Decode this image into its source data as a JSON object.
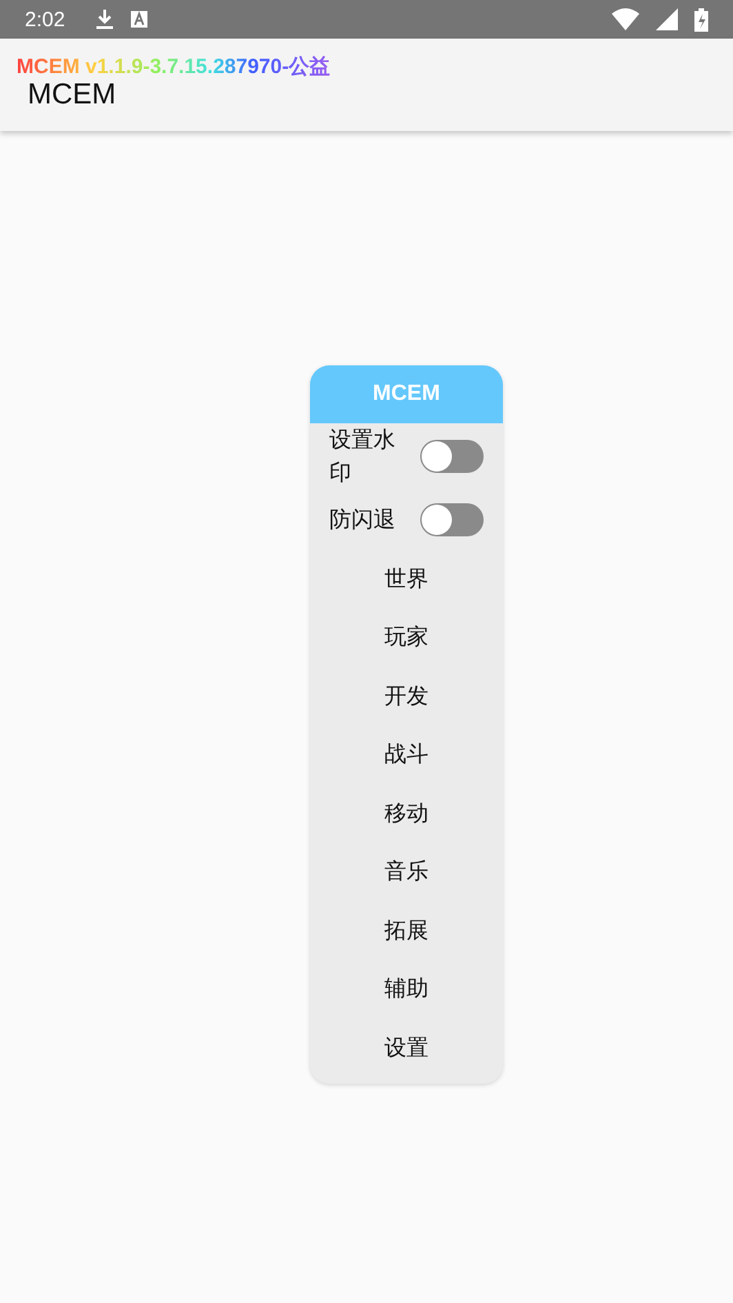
{
  "status_bar": {
    "time": "2:02"
  },
  "app_bar": {
    "title": "MCEM"
  },
  "watermark": {
    "text": "MCEM v1.1.9-3.7.15.287970-公益"
  },
  "panel": {
    "title": "MCEM",
    "items": [
      {
        "kind": "toggle",
        "label": "设置水印",
        "on": false
      },
      {
        "kind": "toggle",
        "label": "防闪退",
        "on": false
      },
      {
        "kind": "button",
        "label": "世界"
      },
      {
        "kind": "button",
        "label": "玩家"
      },
      {
        "kind": "button",
        "label": "开发"
      },
      {
        "kind": "button",
        "label": "战斗"
      },
      {
        "kind": "button",
        "label": "移动"
      },
      {
        "kind": "button",
        "label": "音乐"
      },
      {
        "kind": "button",
        "label": "拓展"
      },
      {
        "kind": "button",
        "label": "辅助"
      },
      {
        "kind": "button",
        "label": "设置"
      }
    ]
  }
}
